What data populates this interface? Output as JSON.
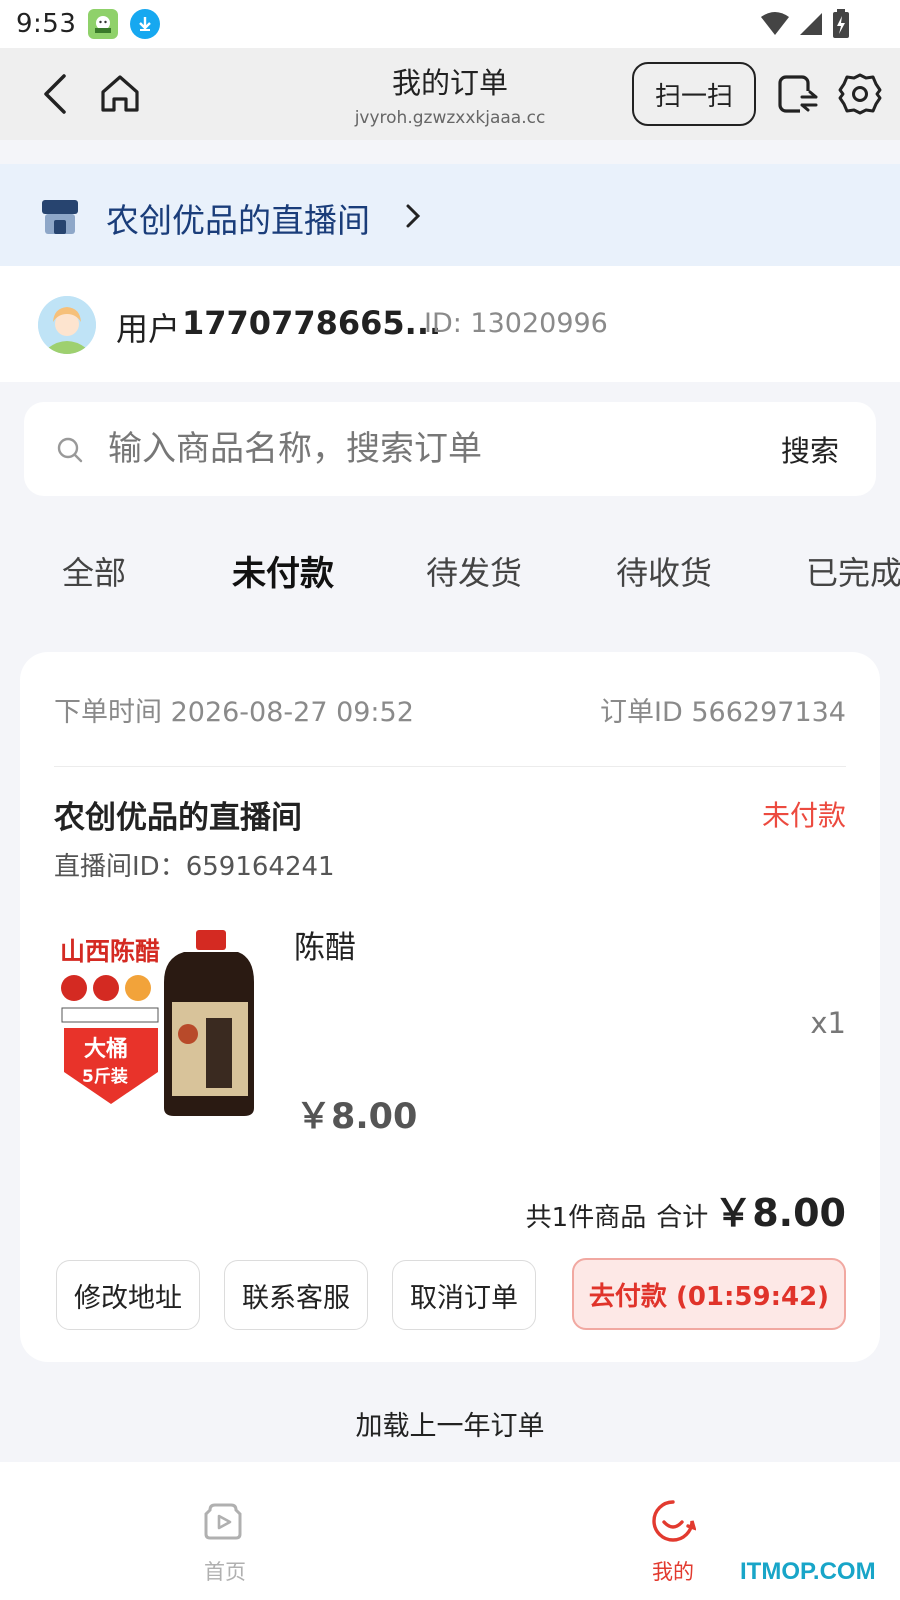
{
  "status_bar": {
    "time": "9:53",
    "icons": [
      "app-icon",
      "download-icon",
      "wifi-icon",
      "signal-icon",
      "battery-icon"
    ]
  },
  "nav": {
    "title": "我的订单",
    "url": "jvyroh.gzwzxxkjaaa.cc",
    "scan_label": "扫一扫",
    "icons": [
      "back-icon",
      "home-icon",
      "rotate-icon",
      "gear-icon"
    ]
  },
  "live_room": {
    "name": "农创优品的直播间"
  },
  "user": {
    "prefix": "用户",
    "name": "1770778665...",
    "id": "ID: 13020996"
  },
  "search": {
    "placeholder": "输入商品名称，搜索订单",
    "value": "",
    "button": "搜索"
  },
  "tabs": [
    {
      "label": "全部",
      "active": false
    },
    {
      "label": "未付款",
      "active": true
    },
    {
      "label": "待发货",
      "active": false
    },
    {
      "label": "待收货",
      "active": false
    },
    {
      "label": "已完成",
      "active": false
    }
  ],
  "order": {
    "time": "下单时间 2026-08-27 09:52",
    "order_id": "订单ID 566297134",
    "shop_name": "农创优品的直播间",
    "status": "未付款",
    "room_id": "直播间ID：659164241",
    "product": {
      "name": "陈醋",
      "image_text": [
        "山西陈醋",
        "大桶",
        "5斤装"
      ],
      "qty": "x1",
      "price": "￥8.00"
    },
    "total_count": "共1件商品",
    "total_label": "合计",
    "total_amount": "￥8.00",
    "actions": [
      "修改地址",
      "联系客服",
      "取消订单"
    ],
    "pay_label": "去付款 (01:59:42)"
  },
  "load_more": "加载上一年订单",
  "bottom_nav": [
    {
      "label": "首页",
      "active": false
    },
    {
      "label": "我的",
      "active": true
    }
  ],
  "watermark": "ITMOP.COM",
  "colors": {
    "accent_red": "#e23a2f",
    "banner_bg": "#e9f1fb",
    "banner_text": "#1a3d7a",
    "page_bg": "#f4f5f9"
  }
}
